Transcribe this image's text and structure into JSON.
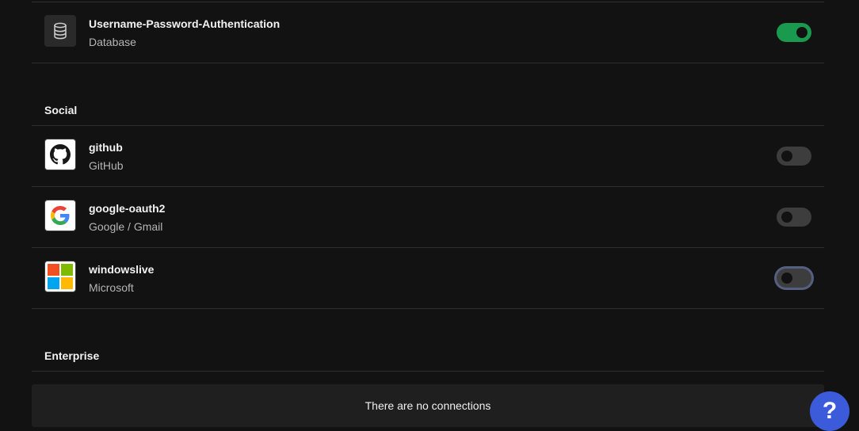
{
  "database": {
    "connections": [
      {
        "name": "Username-Password-Authentication",
        "type": "Database",
        "enabled": true,
        "icon": "database-icon"
      }
    ]
  },
  "social": {
    "title": "Social",
    "connections": [
      {
        "name": "github",
        "type": "GitHub",
        "enabled": false,
        "icon": "github-icon"
      },
      {
        "name": "google-oauth2",
        "type": "Google / Gmail",
        "enabled": false,
        "icon": "google-icon"
      },
      {
        "name": "windowslive",
        "type": "Microsoft",
        "enabled": false,
        "icon": "microsoft-icon"
      }
    ]
  },
  "enterprise": {
    "title": "Enterprise",
    "empty_message": "There are no connections"
  },
  "help": {
    "label": "?",
    "icon": "help-icon"
  },
  "colors": {
    "toggle_on": "#1a9a4f",
    "help_button": "#3b5bdb"
  }
}
